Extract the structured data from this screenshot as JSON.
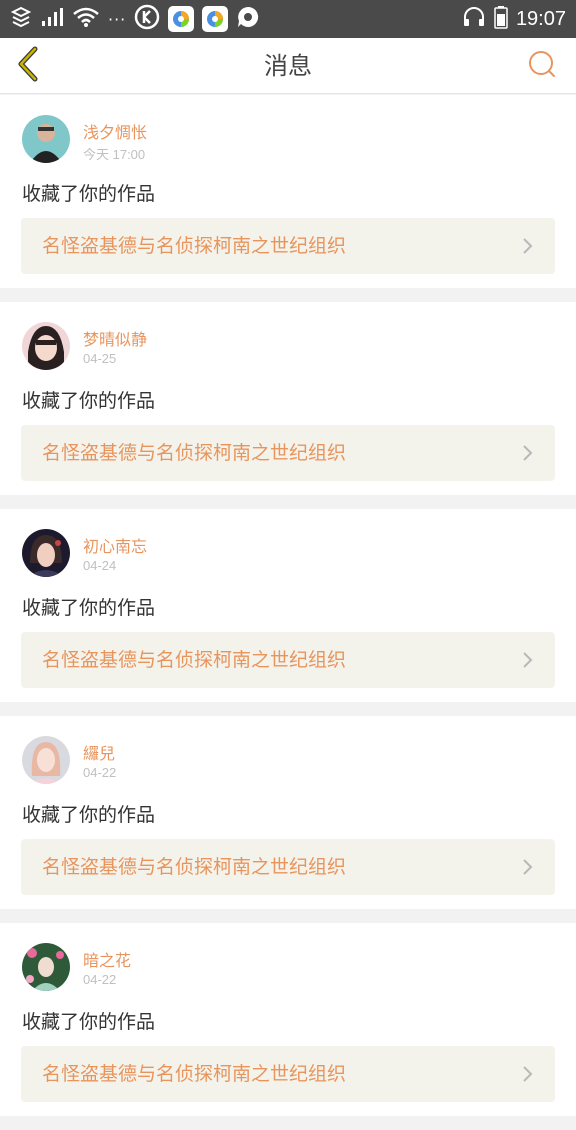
{
  "status_bar": {
    "time": "19:07",
    "icons": [
      "sim-icon",
      "signal-icon",
      "wifi-icon",
      "more-dots-icon",
      "k-app-icon",
      "app-icon",
      "app-icon",
      "chat-bubble-icon",
      "headphones-icon",
      "battery-icon"
    ],
    "dots": "···"
  },
  "nav": {
    "title": "消息",
    "back_icon": "chevron-left-icon",
    "search_icon": "search-icon",
    "accent_color": "#e8955d",
    "back_color": "#c9b400"
  },
  "messages": [
    {
      "user": "浅夕惆怅",
      "time": "今天 17:00",
      "action": "收藏了你的作品",
      "work": "名怪盗基德与名侦探柯南之世纪组织"
    },
    {
      "user": "梦晴似静",
      "time": "04-25",
      "action": "收藏了你的作品",
      "work": "名怪盗基德与名侦探柯南之世纪组织"
    },
    {
      "user": "初心南忘",
      "time": "04-24",
      "action": "收藏了你的作品",
      "work": "名怪盗基德与名侦探柯南之世纪组织"
    },
    {
      "user": "纙兒",
      "time": "04-22",
      "action": "收藏了你的作品",
      "work": "名怪盗基德与名侦探柯南之世纪组织"
    },
    {
      "user": "暗之花",
      "time": "04-22",
      "action": "收藏了你的作品",
      "work": "名怪盗基德与名侦探柯南之世纪组织"
    }
  ]
}
